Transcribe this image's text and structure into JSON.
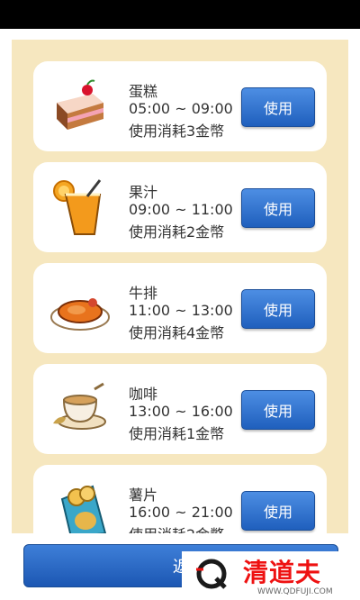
{
  "items": [
    {
      "name": "蛋糕",
      "time": "05:00 ~ 09:00",
      "cost": "使用消耗3金幣",
      "button": "使用",
      "icon": "cake-icon"
    },
    {
      "name": "果汁",
      "time": "09:00 ~ 11:00",
      "cost": "使用消耗2金幣",
      "button": "使用",
      "icon": "juice-icon"
    },
    {
      "name": "牛排",
      "time": "11:00 ~ 13:00",
      "cost": "使用消耗4金幣",
      "button": "使用",
      "icon": "steak-icon"
    },
    {
      "name": "咖啡",
      "time": "13:00 ~ 16:00",
      "cost": "使用消耗1金幣",
      "button": "使用",
      "icon": "coffee-icon"
    },
    {
      "name": "薯片",
      "time": "16:00 ~ 21:00",
      "cost": "使用消耗2金幣",
      "button": "使用",
      "icon": "chips-icon"
    }
  ],
  "back_button": "返",
  "watermark": {
    "brand": "清道夫",
    "url": "WWW.QDFUJI.COM"
  },
  "colors": {
    "panel": "#f6e7bf",
    "button": "#2a6fcf",
    "watermark": "#e11111"
  }
}
